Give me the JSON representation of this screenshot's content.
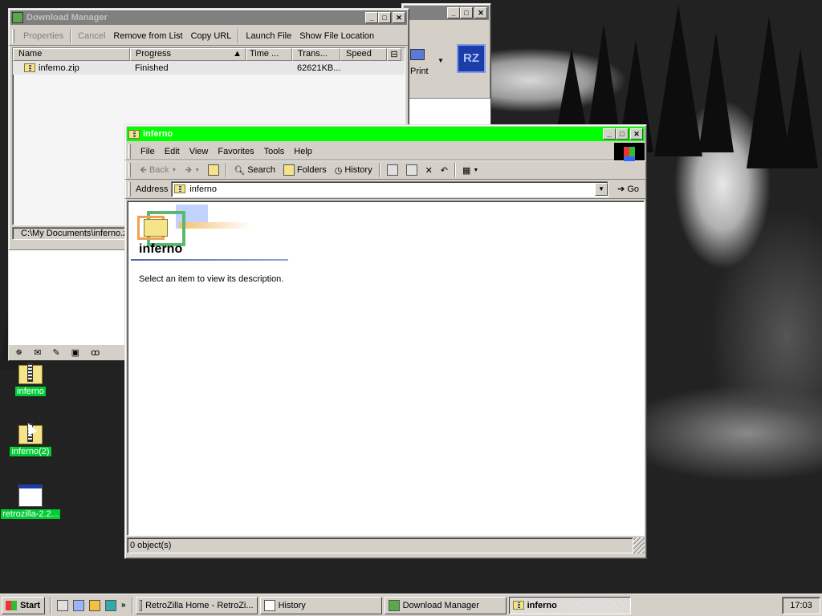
{
  "colors": {
    "active_title": "#00ff00",
    "inactive_title": "#808080",
    "desktop_label": "#00cc33"
  },
  "download_manager": {
    "title": "Download Manager",
    "toolbar": [
      "Properties",
      "Cancel",
      "Remove from List",
      "Copy URL",
      "Launch File",
      "Show File Location"
    ],
    "columns": [
      "Name",
      "Progress",
      "Time ...",
      "Trans...",
      "Speed"
    ],
    "rows": [
      {
        "name": "inferno.zip",
        "progress": "Finished",
        "time": "",
        "transferred": "62621KB...",
        "speed": ""
      }
    ],
    "status": "C:\\My Documents\\inferno.z"
  },
  "browser_behind": {
    "print_label": "Print",
    "logo": "RZ"
  },
  "explorer": {
    "title": "inferno",
    "menu": [
      "File",
      "Edit",
      "View",
      "Favorites",
      "Tools",
      "Help"
    ],
    "toolbar": {
      "back": "Back",
      "search": "Search",
      "folders": "Folders",
      "history": "History"
    },
    "address_label": "Address",
    "address_value": "inferno",
    "go_label": "Go",
    "folder_heading": "inferno",
    "description": "Select an item to view its description.",
    "status": "0 object(s)"
  },
  "desktop_icons": [
    {
      "label": "inferno",
      "icon": "zip-folder-icon"
    },
    {
      "label": "inferno(2)",
      "icon": "zip-folder-icon"
    },
    {
      "label": "retrozilla-2.2...",
      "icon": "window-icon"
    }
  ],
  "taskbar": {
    "start": "Start",
    "tasks": [
      "RetroZilla Home - RetroZi...",
      "History",
      "Download Manager",
      "inferno"
    ],
    "clock": "17:03"
  }
}
